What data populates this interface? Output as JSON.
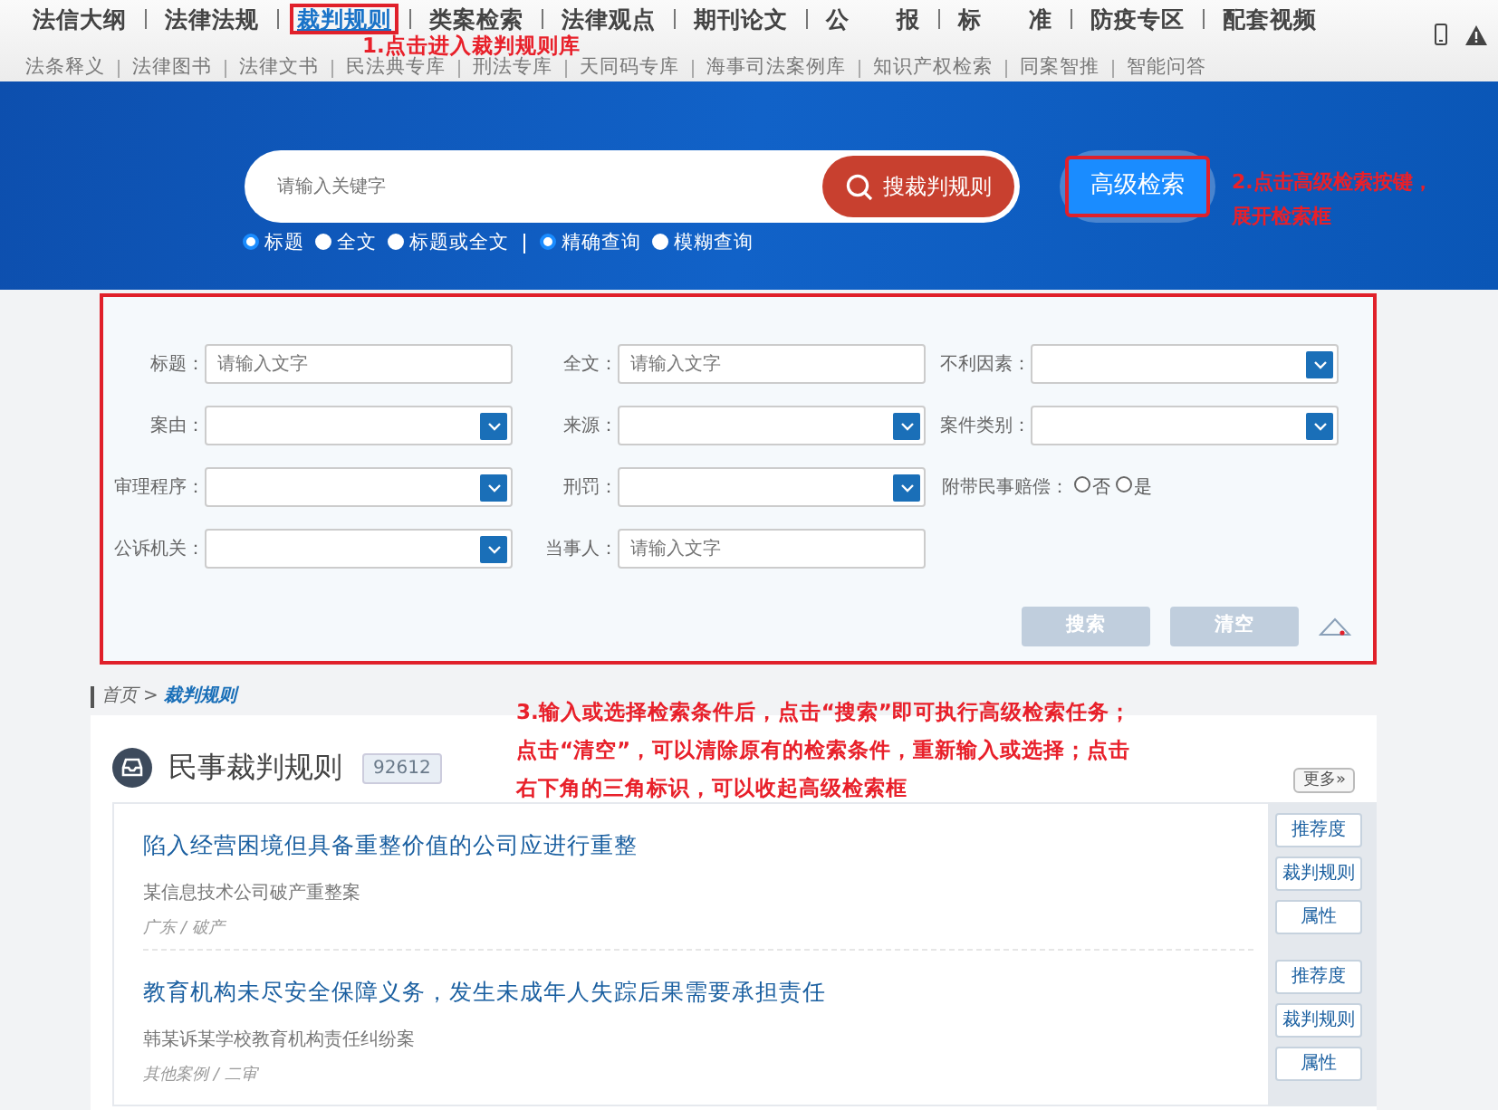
{
  "nav": {
    "primary": [
      {
        "label": "法信大纲",
        "selected": false,
        "highlighted": false
      },
      {
        "label": "法律法规",
        "selected": false,
        "highlighted": false
      },
      {
        "label": "裁判规则",
        "selected": true,
        "highlighted": true
      },
      {
        "label": "类案检索",
        "selected": false,
        "highlighted": false
      },
      {
        "label": "法律观点",
        "selected": false,
        "highlighted": false
      },
      {
        "label": "期刊论文",
        "selected": false,
        "highlighted": false
      },
      {
        "label": "公　　报",
        "selected": false,
        "highlighted": false
      },
      {
        "label": "标　　准",
        "selected": false,
        "highlighted": false
      },
      {
        "label": "防疫专区",
        "selected": false,
        "highlighted": false
      },
      {
        "label": "配套视频",
        "selected": false,
        "highlighted": false
      }
    ],
    "secondary": [
      "法条释义",
      "法律图书",
      "法律文书",
      "民法典专库",
      "刑法专库",
      "天同码专库",
      "海事司法案例库",
      "知识产权检索",
      "同案智推",
      "智能问答"
    ],
    "annotation": "1.点击进入裁判规则库"
  },
  "search": {
    "placeholder": "请输入关键字",
    "button": "搜裁判规则",
    "advanced_button": {
      "label": "高级检索",
      "highlighted": true
    },
    "annotation": [
      "2.点击高级检索按键，",
      "展开检索框"
    ],
    "scope_options": [
      {
        "label": "标题",
        "selected": true
      },
      {
        "label": "全文",
        "selected": false
      },
      {
        "label": "标题或全文",
        "selected": false
      }
    ],
    "match_options": [
      {
        "label": "精确查询",
        "selected": true
      },
      {
        "label": "模糊查询",
        "selected": false
      }
    ]
  },
  "advanced_panel": {
    "highlighted": true,
    "fields": [
      {
        "label": "标题：",
        "kind": "input",
        "placeholder": "请输入文字"
      },
      {
        "label": "全文：",
        "kind": "input",
        "placeholder": "请输入文字"
      },
      {
        "label": "不利因素：",
        "kind": "select"
      },
      {
        "label": "案由：",
        "kind": "select"
      },
      {
        "label": "来源：",
        "kind": "select"
      },
      {
        "label": "案件类别：",
        "kind": "select"
      },
      {
        "label": "审理程序：",
        "kind": "select"
      },
      {
        "label": "刑罚：",
        "kind": "select"
      },
      {
        "label": "附带民事赔偿：",
        "kind": "radio",
        "options": [
          {
            "label": "否",
            "selected": false
          },
          {
            "label": "是",
            "selected": false
          }
        ]
      },
      {
        "label": "公诉机关：",
        "kind": "select"
      },
      {
        "label": "当事人：",
        "kind": "input",
        "placeholder": "请输入文字"
      }
    ],
    "buttons": [
      "搜索",
      "清空"
    ]
  },
  "breadcrumb": [
    "首页",
    "裁判规则"
  ],
  "breadcrumb_separator": ">",
  "annotation": [
    "3.输入或选择检索条件后，点击“搜索”即可执行高级检索任务；",
    "点击“清空”，可以清除原有的检索条件，重新输入或选择；点击",
    "右下角的三角标识，可以收起高级检索框"
  ],
  "section": {
    "title": "民事裁判规则",
    "count": "92612",
    "more": "更多»",
    "items": [
      {
        "title": "陷入经营困境但具备重整价值的公司应进行重整",
        "subtitle": "某信息技术公司破产重整案",
        "meta": "广东 / 破产",
        "actions": [
          "推荐度",
          "裁判规则",
          "属性"
        ]
      },
      {
        "title": "教育机构未尽安全保障义务，发生未成年人失踪后果需要承担责任",
        "subtitle": "韩某诉某学校教育机构责任纠纷案",
        "meta": "其他案例 / 二审",
        "actions": [
          "推荐度",
          "裁判规则",
          "属性"
        ]
      }
    ]
  }
}
